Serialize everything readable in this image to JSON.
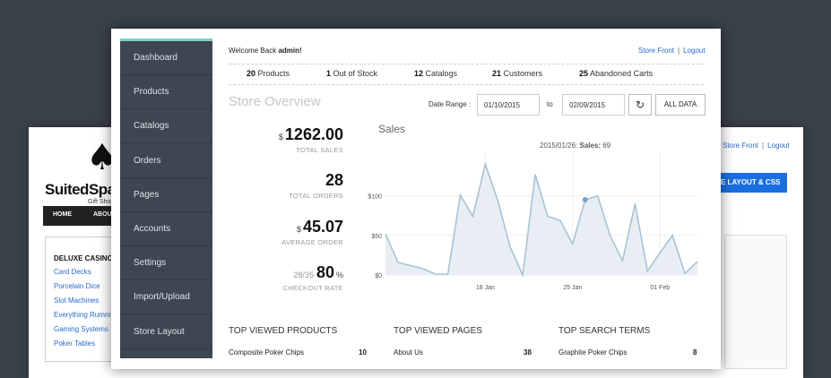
{
  "storefront": {
    "logo_name": "SuitedSpa",
    "logo_sub": "Gift Shop",
    "nav": [
      "HOME",
      "ABOU"
    ],
    "sidebar_title": "DELUXE CASINO",
    "sidebar_items": [
      "Card Decks",
      "Porcelain Dice",
      "Slot Machines",
      "Everything Rummy",
      "Gaming Systems",
      "Poker Tables"
    ],
    "links": {
      "store_front": "Store Front",
      "sep": "|",
      "logout": "Logout"
    },
    "layout_button": "E LAYOUT & CSS"
  },
  "sidebar": {
    "items": [
      "Dashboard",
      "Products",
      "Catalogs",
      "Orders",
      "Pages",
      "Accounts",
      "Settings",
      "Import/Upload",
      "Store Layout"
    ]
  },
  "header": {
    "welcome_prefix": "Welcome Back",
    "user": "admin!",
    "store_front": "Store Front",
    "sep": "|",
    "logout": "Logout"
  },
  "stats": [
    {
      "count": "20",
      "label": "Products"
    },
    {
      "count": "1",
      "label": "Out of Stock"
    },
    {
      "count": "12",
      "label": "Catalogs"
    },
    {
      "count": "21",
      "label": "Customers"
    },
    {
      "count": "25",
      "label": "Abandoned Carts"
    }
  ],
  "overview": {
    "title": "Store Overview",
    "date_range_label": "Date Range :",
    "from": "01/10/2015",
    "to_label": "to",
    "to": "02/09/2015",
    "all_data": "ALL DATA"
  },
  "kpis": {
    "total_sales": {
      "currency": "$",
      "value": "1262.00",
      "label": "TOTAL SALES"
    },
    "total_orders": {
      "value": "28",
      "label": "TOTAL ORDERS"
    },
    "average_order": {
      "currency": "$",
      "value": "45.07",
      "label": "AVERAGE ORDER"
    },
    "checkout_rate": {
      "pre": "28/35",
      "value": "80",
      "suffix": "%",
      "label": "CHECKOUT RATE"
    }
  },
  "chart_data": {
    "type": "area",
    "title": "Sales",
    "tooltip": {
      "date": "2015/01/26:",
      "label": "Sales:",
      "value": "69"
    },
    "y_ticks": [
      "$100",
      "$50",
      "$0"
    ],
    "x_ticks": [
      "18 Jan",
      "25 Jan",
      "01 Feb"
    ],
    "ylim": [
      0,
      155
    ],
    "x": [
      "2015-01-10",
      "2015-01-11",
      "2015-01-12",
      "2015-01-13",
      "2015-01-14",
      "2015-01-15",
      "2015-01-16",
      "2015-01-17",
      "2015-01-18",
      "2015-01-19",
      "2015-01-20",
      "2015-01-21",
      "2015-01-22",
      "2015-01-23",
      "2015-01-24",
      "2015-01-25",
      "2015-01-26",
      "2015-01-27",
      "2015-01-28",
      "2015-01-29",
      "2015-01-30",
      "2015-01-31",
      "2015-02-01",
      "2015-02-02",
      "2015-02-03",
      "2015-02-04",
      "2015-02-05",
      "2015-02-06",
      "2015-02-07",
      "2015-02-08",
      "2015-02-09"
    ],
    "values": [
      52,
      16,
      12,
      8,
      1,
      1,
      101,
      74,
      140,
      94,
      35,
      0,
      127,
      74,
      69,
      39,
      95,
      100,
      50,
      18,
      90,
      5,
      28,
      50,
      2,
      17
    ],
    "grid": true,
    "color": "#a9c2d6",
    "fill": "#e8eef4"
  },
  "top_products": {
    "title": "TOP VIEWED PRODUCTS",
    "rows": [
      {
        "name": "Composite Poker Chips",
        "count": "10"
      }
    ]
  },
  "top_pages": {
    "title": "TOP VIEWED PAGES",
    "rows": [
      {
        "name": "About Us",
        "count": "38"
      }
    ]
  },
  "top_searches": {
    "title": "TOP SEARCH TERMS",
    "rows": [
      {
        "name": "Graphite Poker Chips",
        "count": "8"
      }
    ]
  }
}
